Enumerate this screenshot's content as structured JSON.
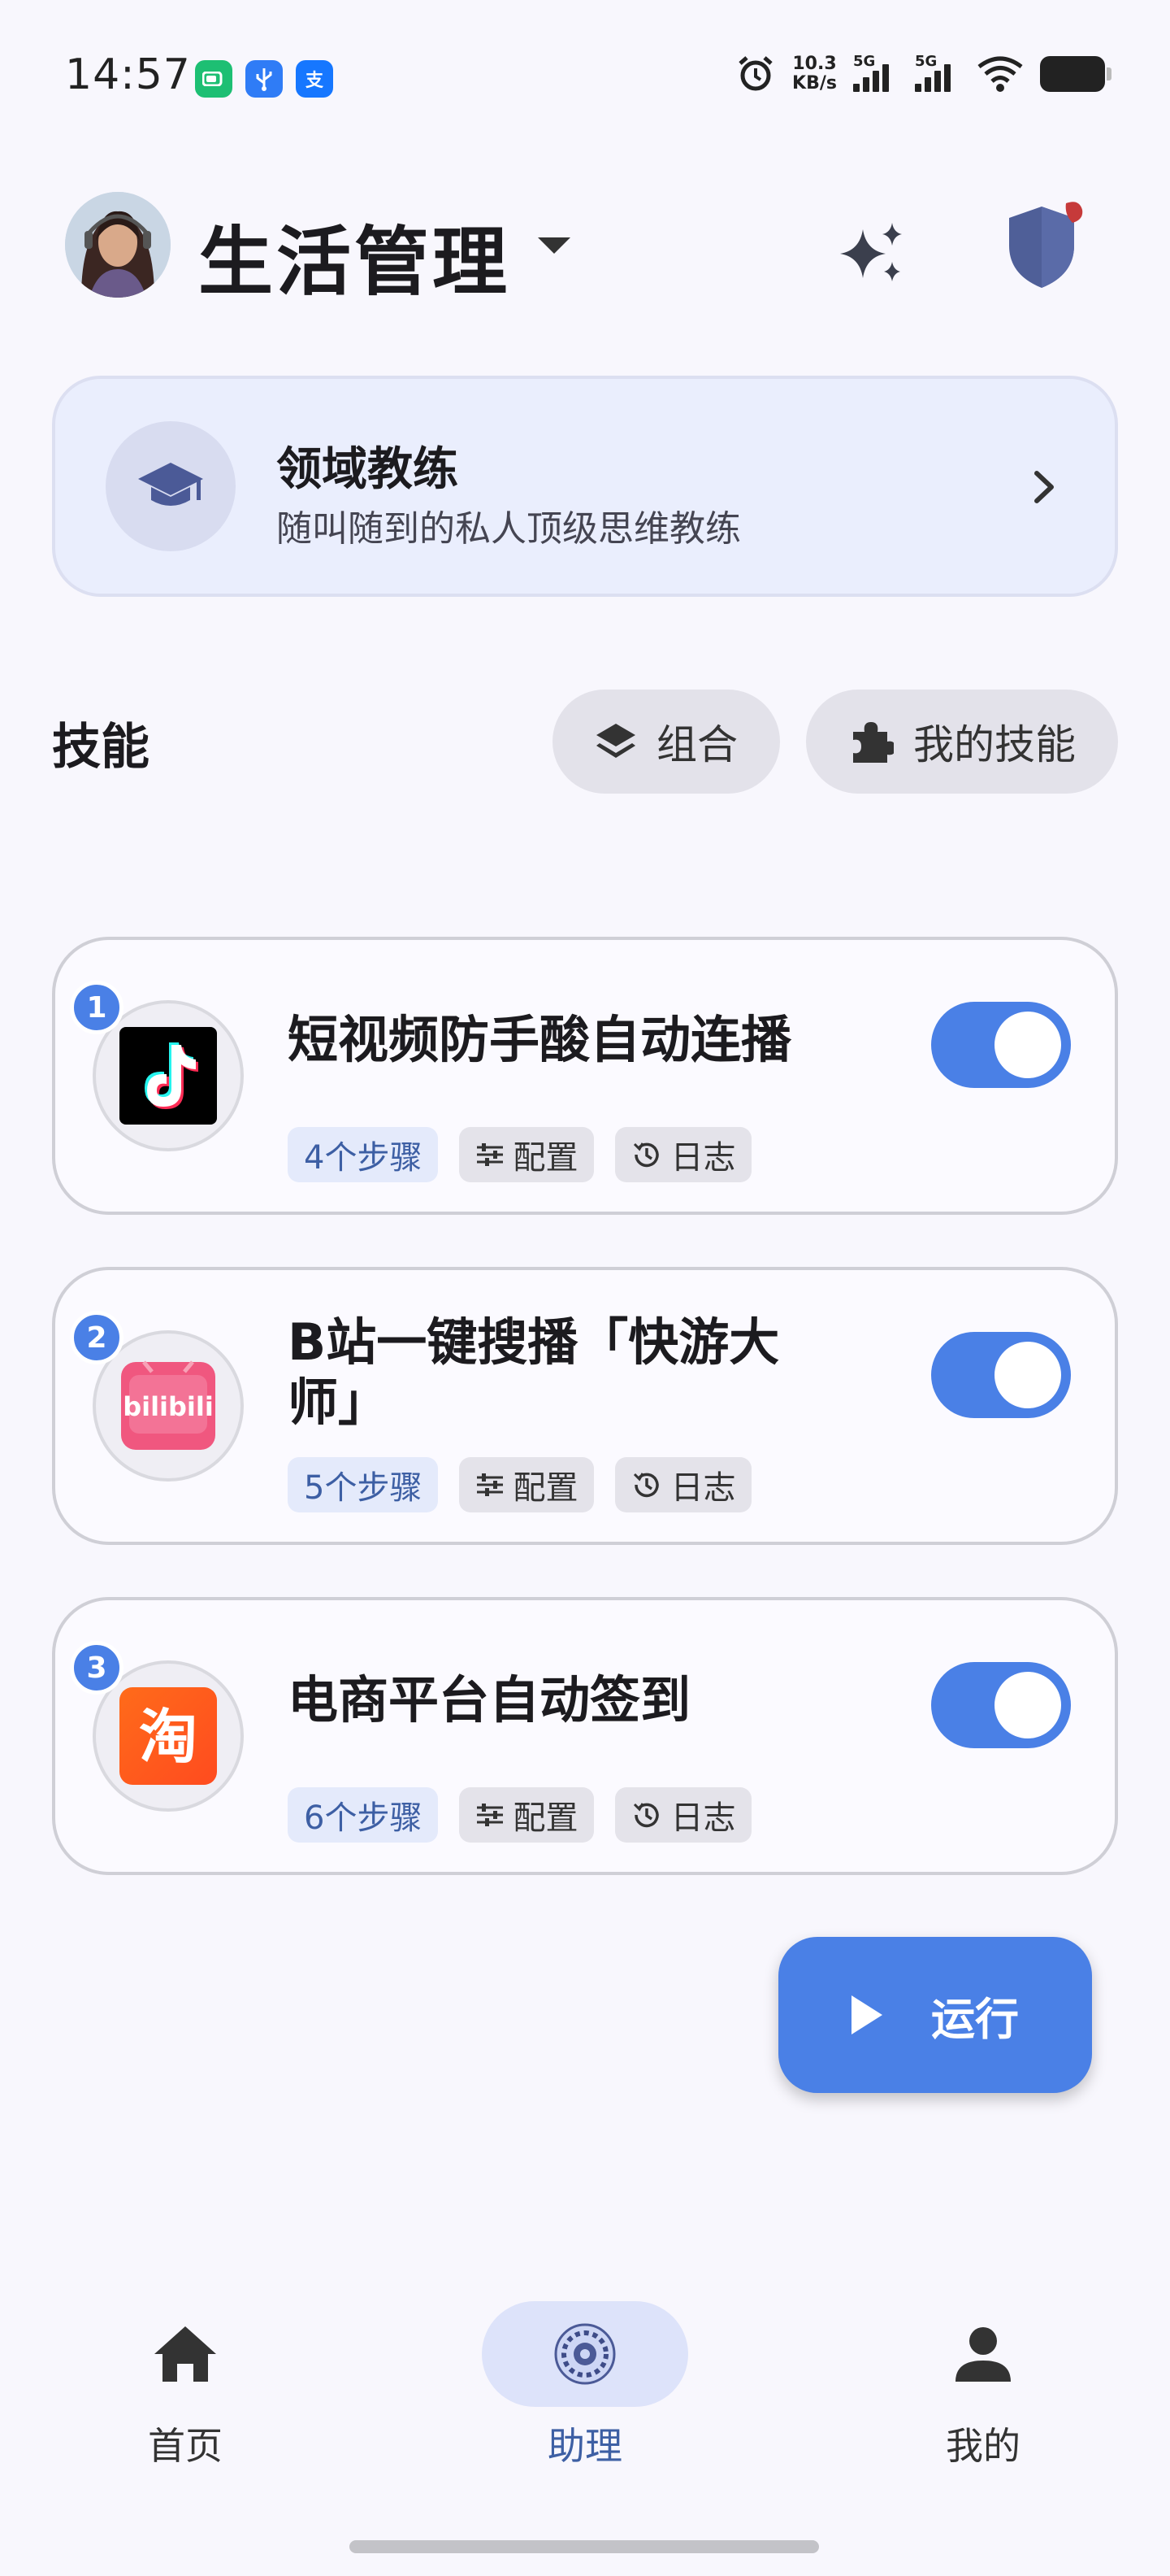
{
  "status_bar": {
    "time": "14:57",
    "net_speed_value": "10.3",
    "net_speed_unit": "KB/s",
    "signal1_label": "5G",
    "signal2_label": "5G",
    "icons": [
      "battery-saver-icon",
      "usb-icon",
      "alipay-icon",
      "alarm-icon",
      "wifi-icon",
      "battery-icon"
    ]
  },
  "header": {
    "title": "生活管理"
  },
  "coach": {
    "title": "领域教练",
    "subtitle": "随叫随到的私人顶级思维教练"
  },
  "skills": {
    "section_title": "技能",
    "combine_label": "组合",
    "my_skills_label": "我的技能",
    "items": [
      {
        "index": "1",
        "title": "短视频防手酸自动连播",
        "steps": "4个步骤",
        "config": "配置",
        "log": "日志",
        "enabled": true,
        "app": "douyin"
      },
      {
        "index": "2",
        "title": "B站一键搜播「快游大师」",
        "steps": "5个步骤",
        "config": "配置",
        "log": "日志",
        "enabled": true,
        "app": "bilibili"
      },
      {
        "index": "3",
        "title": "电商平台自动签到",
        "steps": "6个步骤",
        "config": "配置",
        "log": "日志",
        "enabled": true,
        "app": "taobao"
      }
    ]
  },
  "run_button": {
    "label": "运行"
  },
  "bottom_nav": {
    "items": [
      {
        "label": "首页",
        "icon": "home-icon"
      },
      {
        "label": "助理",
        "icon": "assistant-icon",
        "active": true
      },
      {
        "label": "我的",
        "icon": "person-icon"
      }
    ]
  },
  "colors": {
    "accent": "#4a80e6",
    "background": "#f8f7fd",
    "coach_card": "#eaeefd"
  }
}
